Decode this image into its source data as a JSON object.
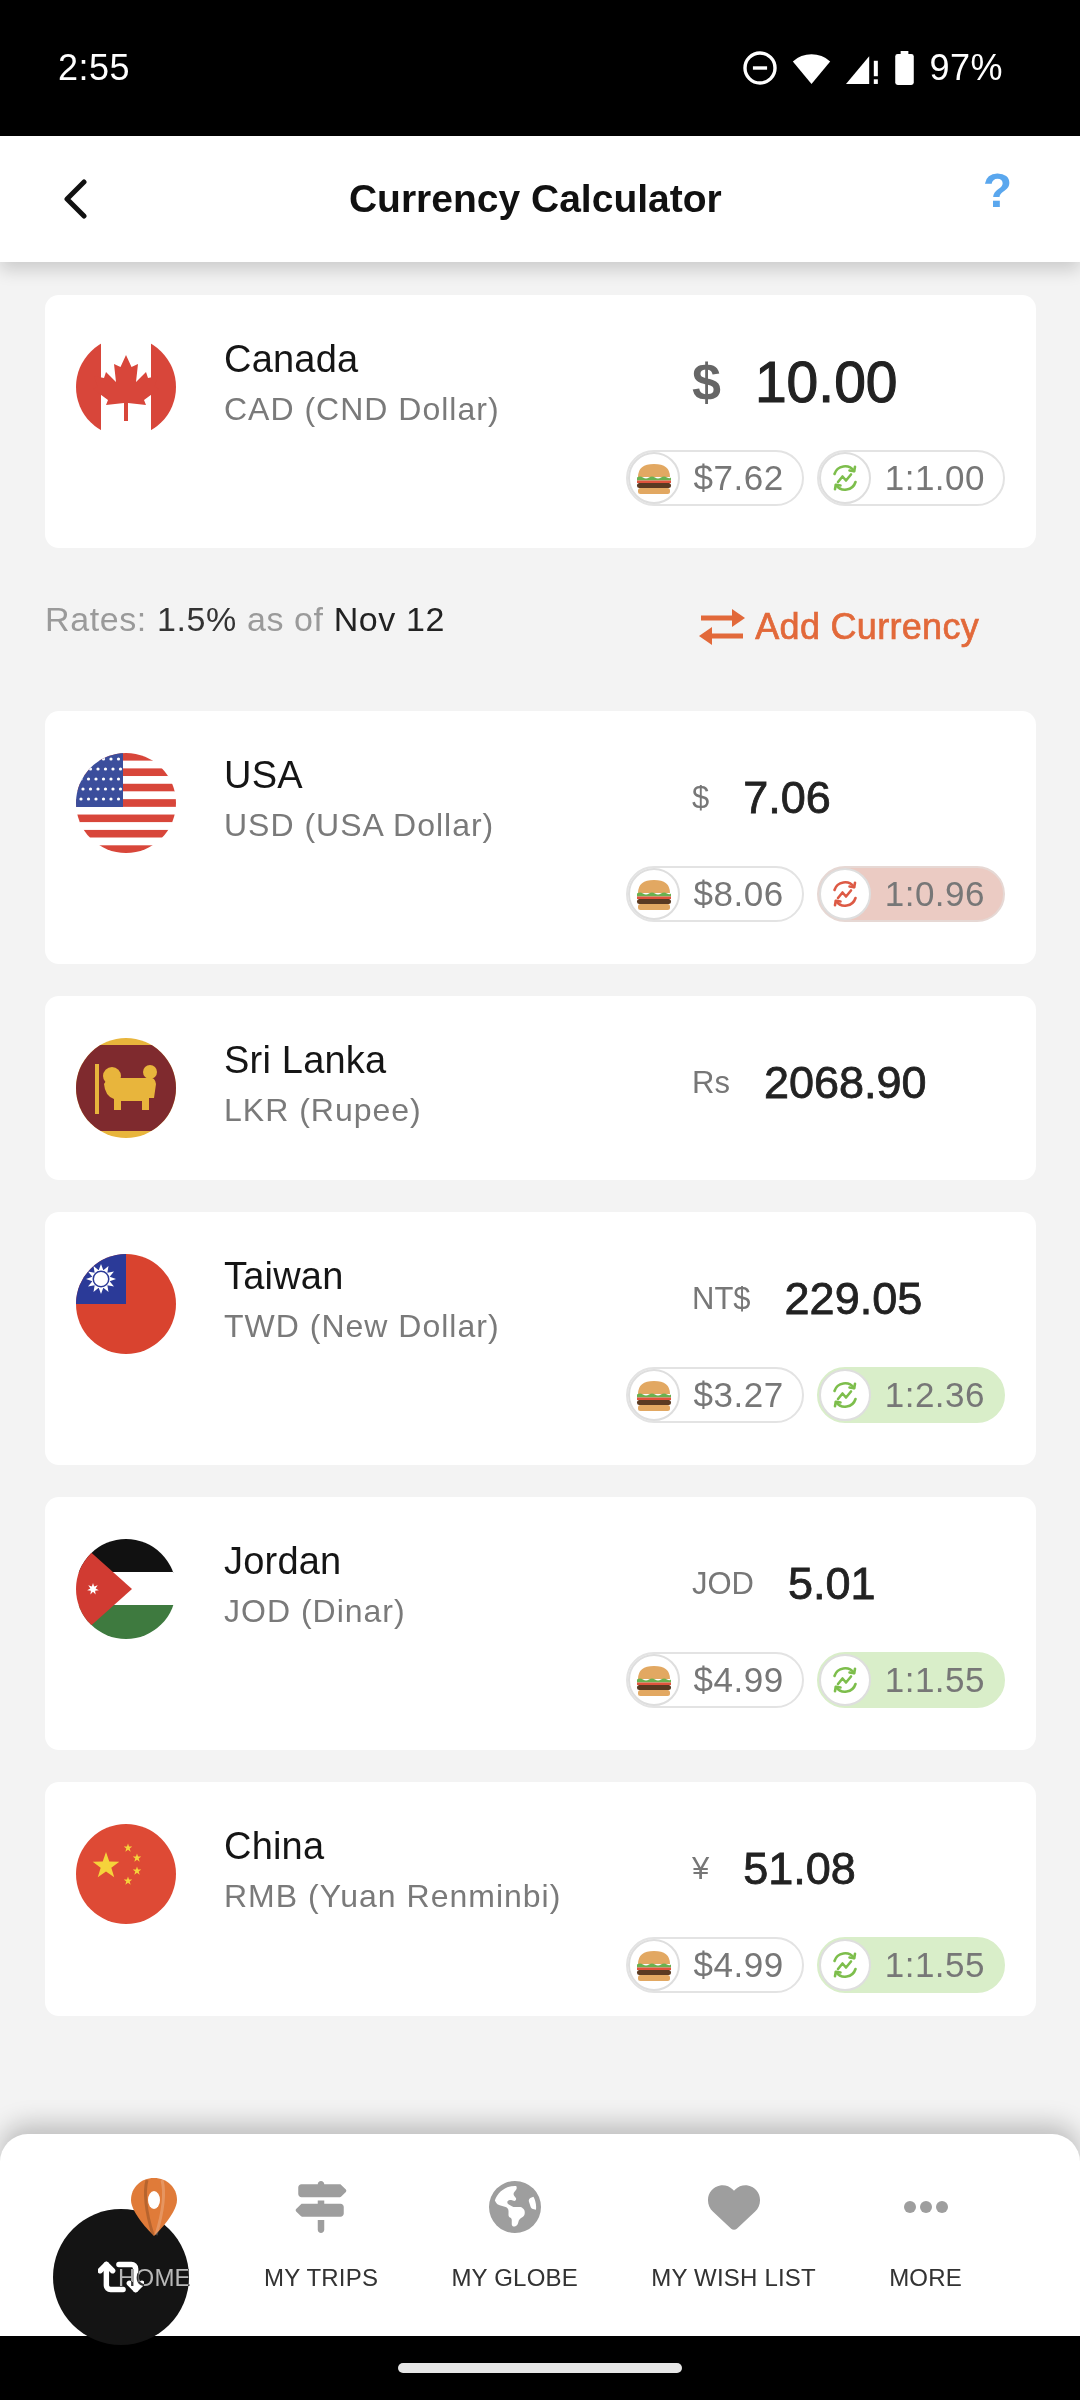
{
  "status_bar": {
    "time": "2:55",
    "battery": "97%"
  },
  "header": {
    "title": "Currency Calculator",
    "help": "?"
  },
  "base_currency": {
    "kind": "ca",
    "country": "Canada",
    "currency": "CAD (CND Dollar)",
    "symbol": "$",
    "amount": "10.00",
    "burger_price": "$7.62",
    "rate": {
      "kind": "even",
      "text": "1:1.00"
    }
  },
  "rates": {
    "label": "Rates:",
    "fee": "1.5%",
    "as_of": "as of",
    "date": "Nov 12",
    "add_button": "Add Currency"
  },
  "currencies": [
    {
      "kind": "us",
      "country": "USA",
      "currency": "USD (USA Dollar)",
      "symbol": "$",
      "amount": "7.06",
      "burger_price": "$8.06",
      "rate": {
        "kind": "down",
        "text": "1:0.96"
      }
    },
    {
      "kind": "lk",
      "country": "Sri Lanka",
      "currency": "LKR (Rupee)",
      "symbol": "Rs",
      "amount": "2068.90"
    },
    {
      "kind": "tw",
      "country": "Taiwan",
      "currency": "TWD (New Dollar)",
      "symbol": "NT$",
      "amount": "229.05",
      "burger_price": "$3.27",
      "rate": {
        "kind": "up",
        "text": "1:2.36"
      }
    },
    {
      "kind": "jo",
      "country": "Jordan",
      "currency": "JOD (Dinar)",
      "symbol": "JOD",
      "amount": "5.01",
      "burger_price": "$4.99",
      "rate": {
        "kind": "up",
        "text": "1:1.55"
      }
    },
    {
      "kind": "cn",
      "country": "China",
      "currency": "RMB (Yuan Renminbi)",
      "symbol": "¥",
      "amount": "51.08",
      "burger_price": "$4.99",
      "rate": {
        "kind": "up",
        "text": "1:1.55"
      }
    }
  ],
  "bottom_nav": {
    "items": [
      {
        "label": "HOME",
        "selected": true
      },
      {
        "label": "MY TRIPS",
        "selected": false
      },
      {
        "label": "MY GLOBE",
        "selected": false
      },
      {
        "label": "MY WISH LIST",
        "selected": false
      },
      {
        "label": "MORE",
        "selected": false
      }
    ]
  }
}
